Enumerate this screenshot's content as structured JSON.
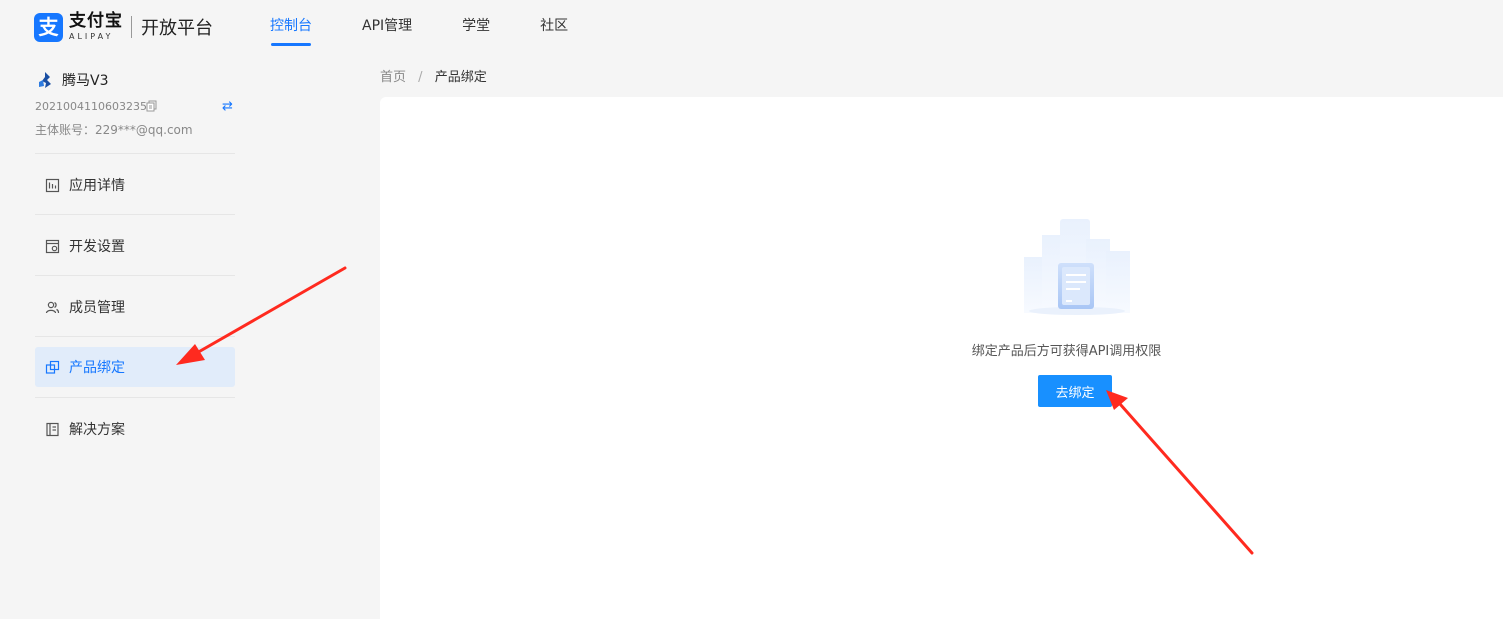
{
  "brand": {
    "logo_glyph": "支",
    "name_cn": "支付宝",
    "name_en": "ALIPAY",
    "platform": "开放平台",
    "color": "#1677ff"
  },
  "nav": {
    "items": [
      {
        "label": "控制台",
        "active": true
      },
      {
        "label": "API管理",
        "active": false
      },
      {
        "label": "学堂",
        "active": false
      },
      {
        "label": "社区",
        "active": false
      }
    ]
  },
  "app": {
    "name": "腾马V3",
    "id": "2021004110603235",
    "master_account": "主体账号：229***@qq.com"
  },
  "sidebar": {
    "items": [
      {
        "label": "应用详情",
        "icon": "chart-icon",
        "active": false
      },
      {
        "label": "开发设置",
        "icon": "settings-icon",
        "active": false
      },
      {
        "label": "成员管理",
        "icon": "members-icon",
        "active": false
      },
      {
        "label": "产品绑定",
        "icon": "bind-icon",
        "active": true
      },
      {
        "label": "解决方案",
        "icon": "book-icon",
        "active": false
      }
    ]
  },
  "breadcrumb": {
    "home": "首页",
    "separator": "/",
    "current": "产品绑定"
  },
  "empty_state": {
    "message": "绑定产品后方可获得API调用权限",
    "button_label": "去绑定"
  },
  "colors": {
    "accent": "#1677ff",
    "button": "#1890ff",
    "active_bg": "#e1ecfa",
    "annotation_arrow": "#ff2a1f"
  }
}
